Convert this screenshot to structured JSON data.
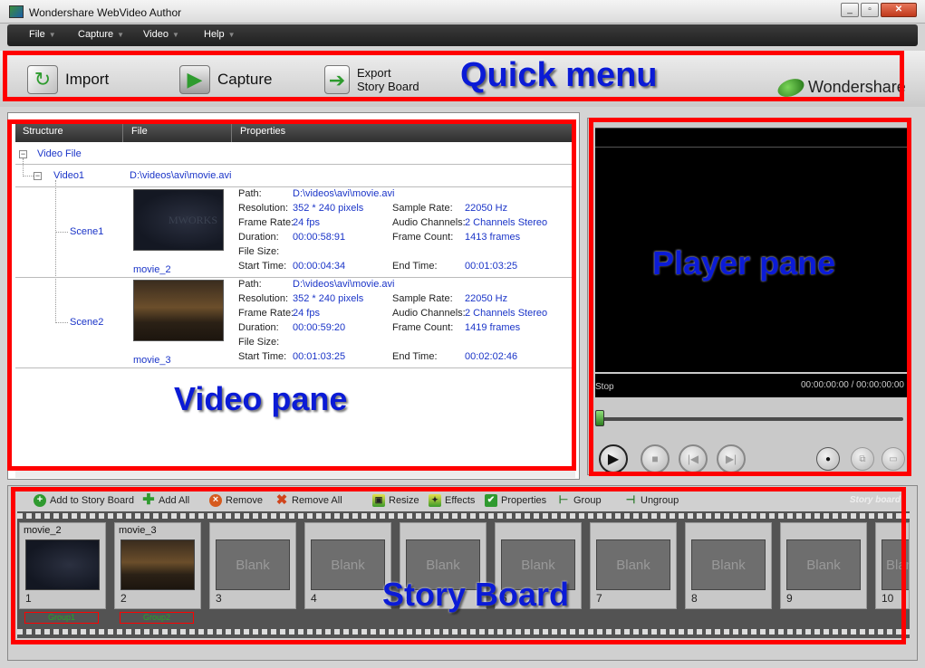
{
  "window": {
    "title": "Wondershare WebVideo Author",
    "controls": {
      "minimize": "_",
      "maximize": "▫",
      "close": "✕"
    }
  },
  "menu": [
    {
      "label": "File"
    },
    {
      "label": "Capture"
    },
    {
      "label": "Video"
    },
    {
      "label": "Help"
    }
  ],
  "quick_menu": {
    "import_label": "Import",
    "capture_label": "Capture",
    "export_line1": "Export",
    "export_line2": "Story Board",
    "brand": "Wondershare",
    "annotation": "Quick menu"
  },
  "video_pane": {
    "annotation": "Video pane",
    "columns": [
      "Structure",
      "File",
      "Properties"
    ],
    "root": "Video File",
    "video": {
      "name": "Video1",
      "file": "D:\\videos\\avi\\movie.avi"
    },
    "labels": {
      "path": "Path:",
      "resolution": "Resolution:",
      "frame_rate": "Frame Rate:",
      "duration": "Duration:",
      "file_size": "File Size:",
      "start_time": "Start Time:",
      "sample_rate": "Sample Rate:",
      "audio_channels": "Audio Channels:",
      "frame_count": "Frame Count:",
      "end_time": "End Time:"
    },
    "scenes": [
      {
        "name": "Scene1",
        "thumb_caption": "movie_2",
        "path": "D:\\videos\\avi\\movie.avi",
        "resolution": "352 * 240 pixels",
        "frame_rate": "24 fps",
        "duration": "00:00:58:91",
        "start_time": "00:00:04:34",
        "sample_rate": "22050 Hz",
        "audio_channels": "2 Channels Stereo",
        "frame_count": "1413 frames",
        "end_time": "00:01:03:25"
      },
      {
        "name": "Scene2",
        "thumb_caption": "movie_3",
        "path": "D:\\videos\\avi\\movie.avi",
        "resolution": "352 * 240 pixels",
        "frame_rate": "24 fps",
        "duration": "00:00:59:20",
        "start_time": "00:01:03:25",
        "sample_rate": "22050 Hz",
        "audio_channels": "2 Channels Stereo",
        "frame_count": "1419 frames",
        "end_time": "00:02:02:46"
      }
    ]
  },
  "player": {
    "annotation": "Player pane",
    "status": "Stop",
    "time": "00:00:00:00 / 00:00:00:00",
    "position": 0
  },
  "story_board": {
    "annotation": "Story Board",
    "label": "Story board",
    "toolbar": {
      "add_to_story_board": "Add to Story Board",
      "add_all": "Add All",
      "remove": "Remove",
      "remove_all": "Remove All",
      "resize": "Resize",
      "effects": "Effects",
      "properties": "Properties",
      "group": "Group",
      "ungroup": "Ungroup"
    },
    "cells": [
      {
        "name": "movie_2",
        "num": "1",
        "group": "Group1"
      },
      {
        "name": "movie_3",
        "num": "2",
        "group": "Group2"
      },
      {
        "blank": "Blank",
        "num": "3"
      },
      {
        "blank": "Blank",
        "num": "4"
      },
      {
        "blank": "Blank",
        "num": "5"
      },
      {
        "blank": "Blank",
        "num": "6"
      },
      {
        "blank": "Blank",
        "num": "7"
      },
      {
        "blank": "Blank",
        "num": "8"
      },
      {
        "blank": "Blank",
        "num": "9"
      },
      {
        "blank": "Blank",
        "num": "10"
      }
    ]
  }
}
